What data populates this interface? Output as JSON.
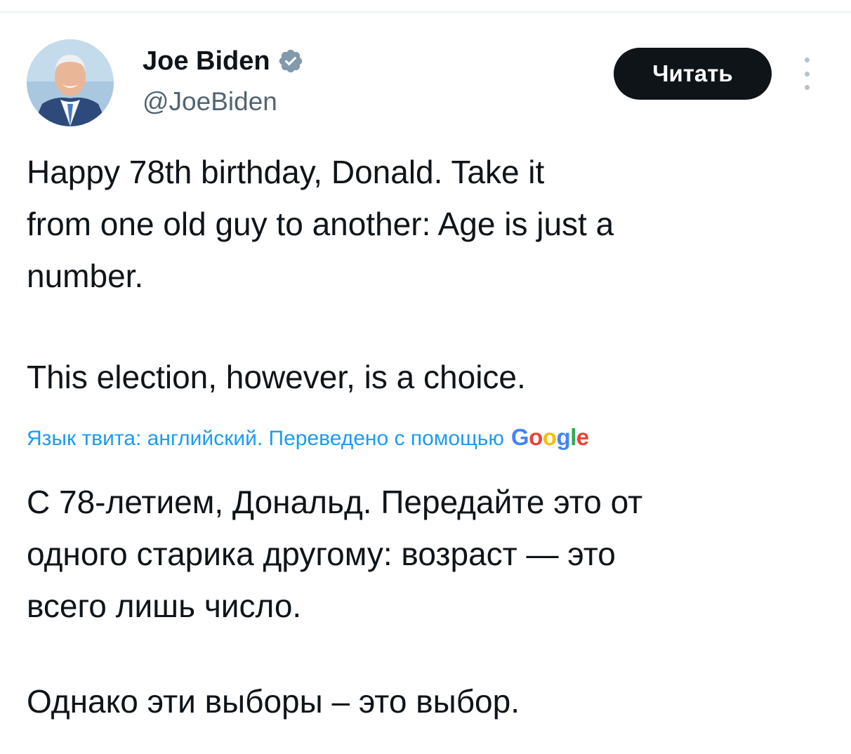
{
  "author": {
    "display_name": "Joe Biden",
    "handle": "@JoeBiden",
    "verified": true
  },
  "follow_button": {
    "label": "Читать"
  },
  "icons": {
    "avatar": "avatar-photo",
    "verified": "verified-badge-icon",
    "more": "more-vertical-icon"
  },
  "tweet": {
    "paragraph_1": "Happy 78th birthday, Donald. Take it\nfrom one old guy to another: Age is just a\nnumber.",
    "paragraph_2": "This election, however, is a choice."
  },
  "translation": {
    "label": "Язык твита: английский. Переведено с помощью",
    "provider": "Google",
    "paragraph_1": "С 78-летием, Дональд. Передайте это от\nодного старика другому: возраст — это\nвсего лишь число.",
    "paragraph_2": "Однако эти выборы – это выбор."
  },
  "colors": {
    "text": "#0f1419",
    "secondary": "#536471",
    "link": "#1d9bf0",
    "button_bg": "#0f1419",
    "verified_badge": "#829aab"
  }
}
